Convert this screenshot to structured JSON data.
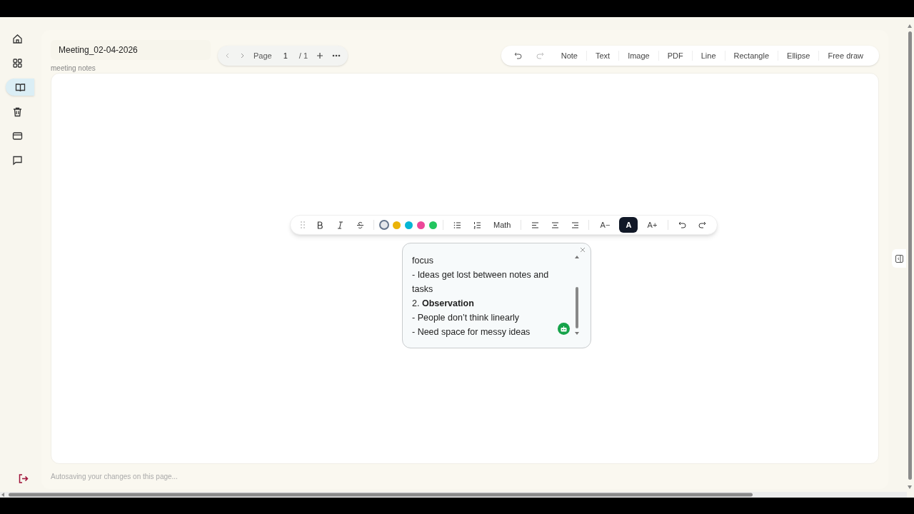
{
  "sidebar": {
    "items": [
      {
        "kind": "home",
        "selected": false
      },
      {
        "kind": "grid",
        "selected": false
      },
      {
        "kind": "book",
        "selected": true
      },
      {
        "kind": "trash",
        "selected": false
      },
      {
        "kind": "card",
        "selected": false
      },
      {
        "kind": "chat",
        "selected": false
      }
    ]
  },
  "document": {
    "title": "Meeting_02-04-2026",
    "subtitle": "meeting notes"
  },
  "pager": {
    "label": "Page",
    "current": "1",
    "total": "/ 1"
  },
  "tools": [
    "Note",
    "Text",
    "Image",
    "PDF",
    "Line",
    "Rectangle",
    "Ellipse",
    "Free draw"
  ],
  "format_bar": {
    "math": "Math",
    "colors": [
      {
        "color": "#e5e7eb",
        "selected": true
      },
      {
        "color": "#eab308",
        "selected": false
      },
      {
        "color": "#06b6d4",
        "selected": false
      },
      {
        "color": "#ec4899",
        "selected": false
      },
      {
        "color": "#22c55e",
        "selected": false
      }
    ],
    "size_buttons": [
      {
        "label": "A−",
        "selected": false
      },
      {
        "label": "A",
        "selected": true
      },
      {
        "label": "A+",
        "selected": false
      }
    ]
  },
  "note": {
    "lines": [
      "focus",
      "- Ideas get lost between notes and tasks",
      "2. **Observation**",
      "- People don’t think linearly",
      "- Need space for messy ideas"
    ]
  },
  "status": "Autosaving your changes on this page..."
}
